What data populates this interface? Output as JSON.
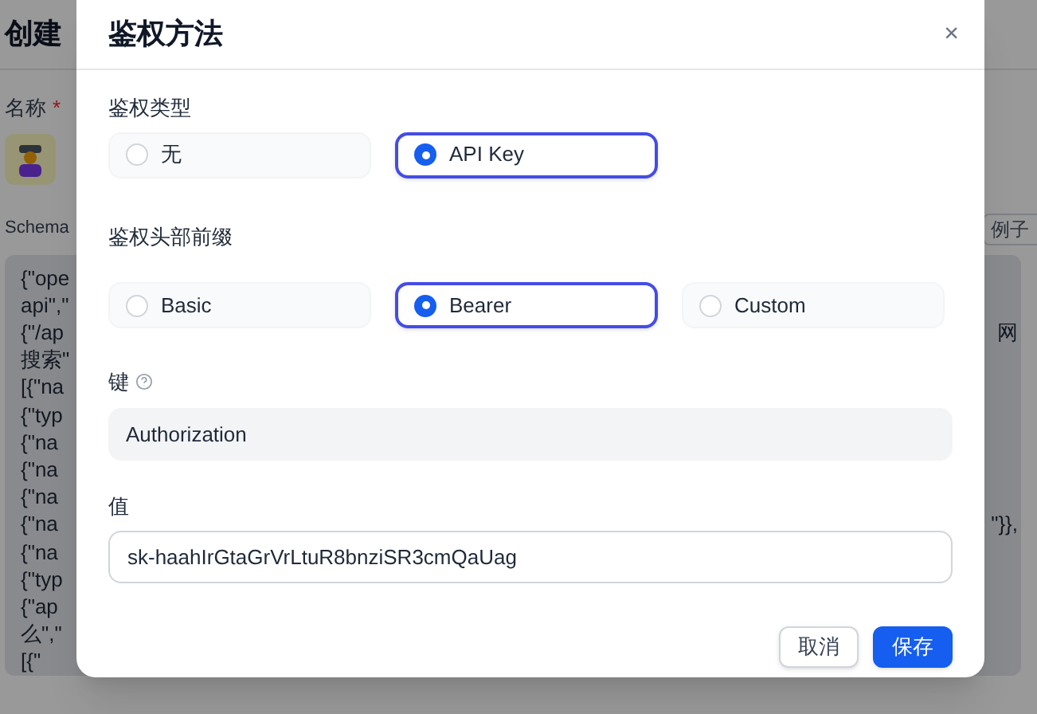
{
  "background": {
    "title": "创建",
    "name_label": "名称",
    "required_mark": "*",
    "schema_label": "Schema",
    "examples_button": "例子",
    "code_lines": [
      {
        "left": "{\"ope"
      },
      {
        "left": "api\",\""
      },
      {
        "left": "{\"/ap",
        "right": "网"
      },
      {
        "left": "搜索\""
      },
      {
        "left": "[{\"na"
      },
      {
        "left": "{\"typ"
      },
      {
        "left": "{\"na"
      },
      {
        "left": "{\"na"
      },
      {
        "left": "{\"na"
      },
      {
        "left": "{\"na",
        "right": "\"}},"
      },
      {
        "left": "{\"na"
      },
      {
        "left": "{\"typ"
      },
      {
        "left": "{\"ap"
      },
      {
        "left": "么\",\""
      },
      {
        "left": "[{\""
      }
    ]
  },
  "dialog": {
    "title": "鉴权方法",
    "close": "×",
    "auth_type": {
      "label": "鉴权类型",
      "options": [
        {
          "label": "无",
          "selected": false
        },
        {
          "label": "API Key",
          "selected": true
        }
      ]
    },
    "header_prefix": {
      "label": "鉴权头部前缀",
      "options": [
        {
          "label": "Basic",
          "selected": false
        },
        {
          "label": "Bearer",
          "selected": true
        },
        {
          "label": "Custom",
          "selected": false
        }
      ]
    },
    "key": {
      "label": "键",
      "value": "Authorization"
    },
    "value": {
      "label": "值",
      "value": "sk-haahIrGtaGrVrLtuR8bnziSR3cmQaUag"
    },
    "buttons": [
      {
        "label": "取消",
        "kind": "secondary"
      },
      {
        "label": "保存",
        "kind": "primary"
      }
    ]
  }
}
